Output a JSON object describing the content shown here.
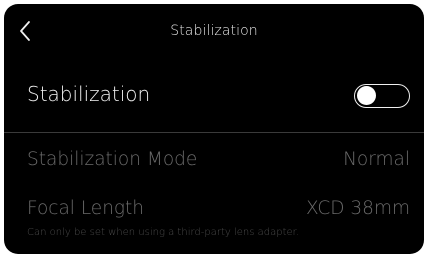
{
  "header": {
    "title": "Stabilization",
    "back_icon": "chevron-left-icon"
  },
  "stabilization": {
    "label": "Stabilization",
    "toggle_state": "off"
  },
  "settings": {
    "mode": {
      "label": "Stabilization Mode",
      "value": "Normal"
    },
    "focal_length": {
      "label": "Focal Length",
      "value": "XCD 38mm",
      "note": "Can only be set when using a third-party lens adapter."
    }
  },
  "colors": {
    "background": "#000000",
    "primary_text": "#f2f2f2",
    "disabled_text": "#6b6b6b",
    "note_text": "#4a4a4a",
    "divider": "#3a3a3a"
  }
}
